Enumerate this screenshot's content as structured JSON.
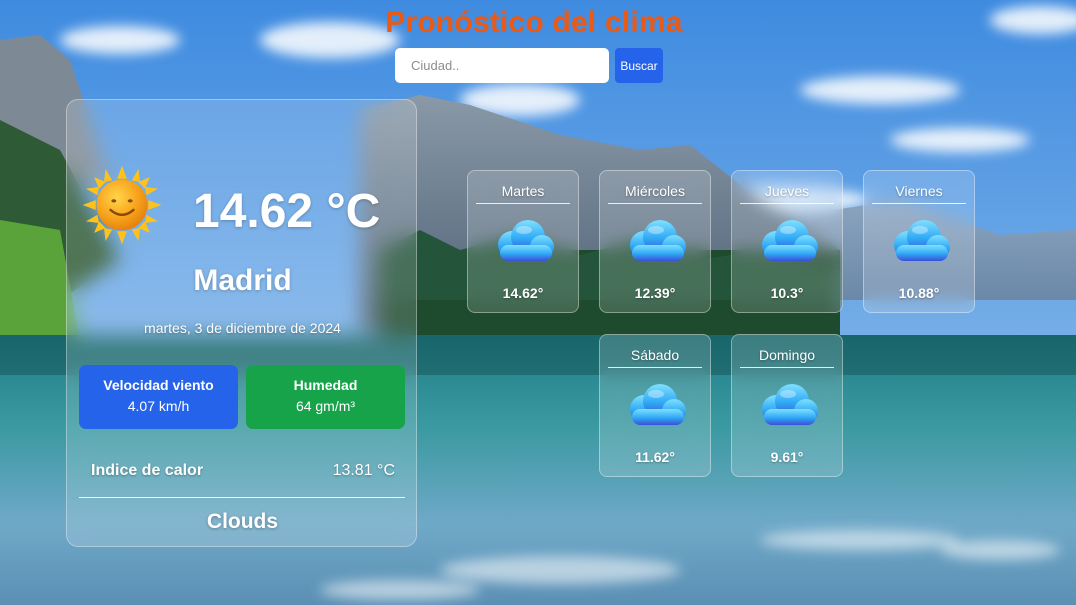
{
  "header": {
    "title": "Pronóstico del clima",
    "title_color": "#ea5a14"
  },
  "search": {
    "placeholder": "Ciudad..",
    "value": "",
    "button_label": "Buscar",
    "button_color": "#2563eb"
  },
  "current": {
    "icon": "sun-icon",
    "temperature": "14.62 °C",
    "city": "Madrid",
    "date": "martes, 3 de diciembre de 2024",
    "wind_label": "Velocidad viento",
    "wind_value": "4.07 km/h",
    "wind_color": "#2563eb",
    "humidity_label": "Humedad",
    "humidity_value": "64 gm/m³",
    "humidity_color": "#16a34a",
    "heat_label": "Indice de calor",
    "heat_value": "13.81 °C",
    "condition": "Clouds"
  },
  "forecast": [
    {
      "day": "Martes",
      "temp": "14.62°",
      "icon": "cloud-icon"
    },
    {
      "day": "Miércoles",
      "temp": "12.39°",
      "icon": "cloud-icon"
    },
    {
      "day": "Jueves",
      "temp": "10.3°",
      "icon": "cloud-icon"
    },
    {
      "day": "Viernes",
      "temp": "10.88°",
      "icon": "cloud-icon"
    },
    {
      "day": "Sábado",
      "temp": "11.62°",
      "icon": "cloud-icon"
    },
    {
      "day": "Domingo",
      "temp": "9.61°",
      "icon": "cloud-icon"
    }
  ]
}
